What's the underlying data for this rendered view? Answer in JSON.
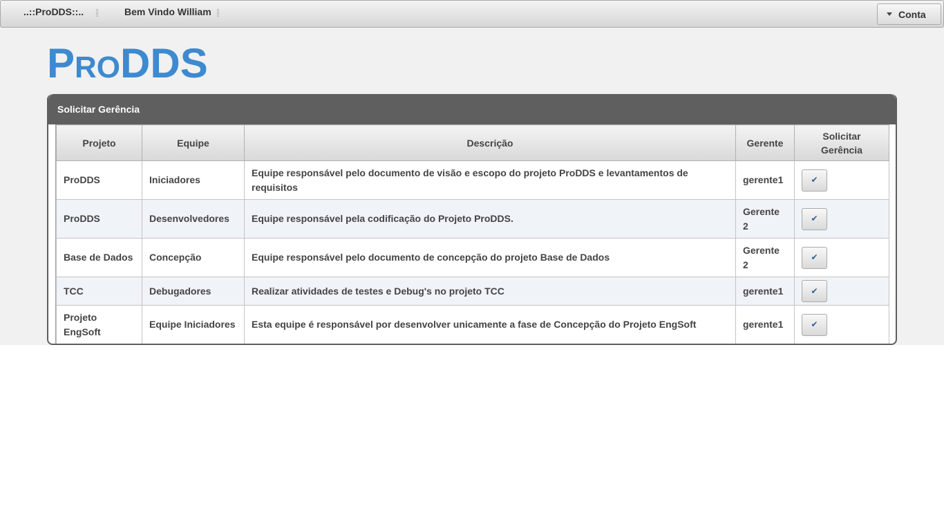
{
  "menubar": {
    "brand": "..::ProDDS::..",
    "welcome": "Bem Vindo William",
    "account_label": "Conta"
  },
  "logo": {
    "first": "P",
    "middle": "RO",
    "last": "DDS"
  },
  "panel": {
    "title": "Solicitar Gerência",
    "columns": [
      "Projeto",
      "Equipe",
      "Descrição",
      "Gerente",
      "Solicitar Gerência"
    ],
    "rows": [
      {
        "projeto": "ProDDS",
        "equipe": "Iniciadores",
        "descricao": "Equipe responsável pelo documento de visão e escopo do projeto ProDDS e levantamentos de requisitos",
        "gerente": "gerente1"
      },
      {
        "projeto": "ProDDS",
        "equipe": "Desenvolvedores",
        "descricao": "Equipe responsável pela codificação do Projeto ProDDS.",
        "gerente": "Gerente 2"
      },
      {
        "projeto": "Base de Dados",
        "equipe": "Concepção",
        "descricao": "Equipe responsável pelo documento de concepção do projeto Base de Dados",
        "gerente": "Gerente 2"
      },
      {
        "projeto": "TCC",
        "equipe": "Debugadores",
        "descricao": "Realizar atividades de testes e Debug's no projeto TCC",
        "gerente": "gerente1"
      },
      {
        "projeto": "Projeto EngSoft",
        "equipe": "Equipe Iniciadores",
        "descricao": "Esta equipe é responsável por desenvolver unicamente a fase de Concepção do Projeto EngSoft",
        "gerente": "gerente1"
      }
    ],
    "action_icon": "check-icon"
  }
}
